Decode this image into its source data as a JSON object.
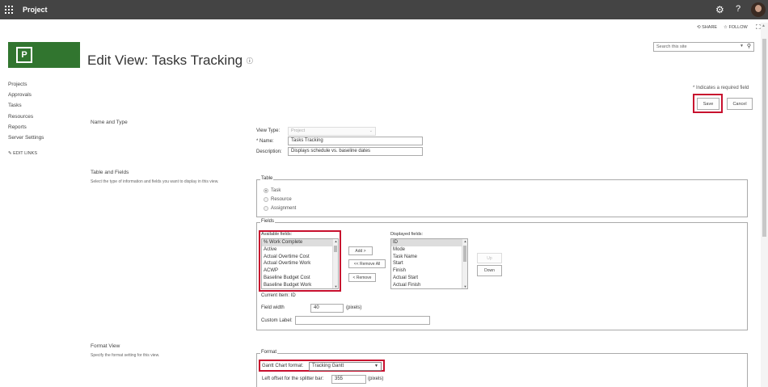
{
  "suite": {
    "app_name": "Project",
    "gear_icon": "gear-icon",
    "help": "?"
  },
  "actions": {
    "share": "SHARE",
    "follow": "FOLLOW"
  },
  "search": {
    "placeholder": "Search this site"
  },
  "title": "Edit View: Tasks Tracking",
  "quick_launch": {
    "items": [
      "Projects",
      "Approvals",
      "Tasks",
      "Resources",
      "Reports",
      "Server Settings"
    ],
    "edit_links": "EDIT LINKS"
  },
  "required_note": "* Indicates a required field",
  "buttons": {
    "save": "Save",
    "cancel": "Cancel"
  },
  "name_type": {
    "title": "Name and Type",
    "view_type_label": "View Type:",
    "view_type_value": "Project",
    "name_label": "Name:",
    "name_required_mark": "*",
    "name_value": "Tasks Tracking",
    "description_label": "Description:",
    "description_value": "Displays schedule vs. baseline dates"
  },
  "table_fields": {
    "title": "Table and Fields",
    "description": "Select the type of information and fields you want to display in this view.",
    "table_legend": "Table",
    "table_options": [
      "Task",
      "Resource",
      "Assignment"
    ],
    "table_selected": "Task",
    "fields_legend": "Fields",
    "available_label": "Available fields:",
    "available_fields": [
      "% Work Complete",
      "Active",
      "Actual Overtime Cost",
      "Actual Overtime Work",
      "ACWP",
      "Baseline Budget Cost",
      "Baseline Budget Work"
    ],
    "displayed_label": "Displayed fields:",
    "displayed_fields": [
      "ID",
      "Mode",
      "Task Name",
      "Start",
      "Finish",
      "Actual Start",
      "Actual Finish"
    ],
    "add_button": "Add >",
    "remove_all_button": "<< Remove All",
    "remove_button": "< Remove",
    "up_button": "Up",
    "down_button": "Down",
    "current_item": "Current Item: ID",
    "field_width_label": "Field width",
    "field_width_value": "40",
    "field_width_unit": "(pixels)",
    "custom_label": "Custom Label:",
    "custom_label_value": ""
  },
  "format_view": {
    "title": "Format View",
    "description": "Specify the format setting for this view.",
    "legend": "Format",
    "gantt_label": "Gantt Chart format:",
    "gantt_value": "Tracking Gantt",
    "offset_label": "Left offset for the splitter bar:",
    "offset_value": "355",
    "offset_unit": "(pixels)"
  },
  "colors": {
    "suitebar": "#444444",
    "logo": "#31752f",
    "highlight": "#c8102e"
  }
}
